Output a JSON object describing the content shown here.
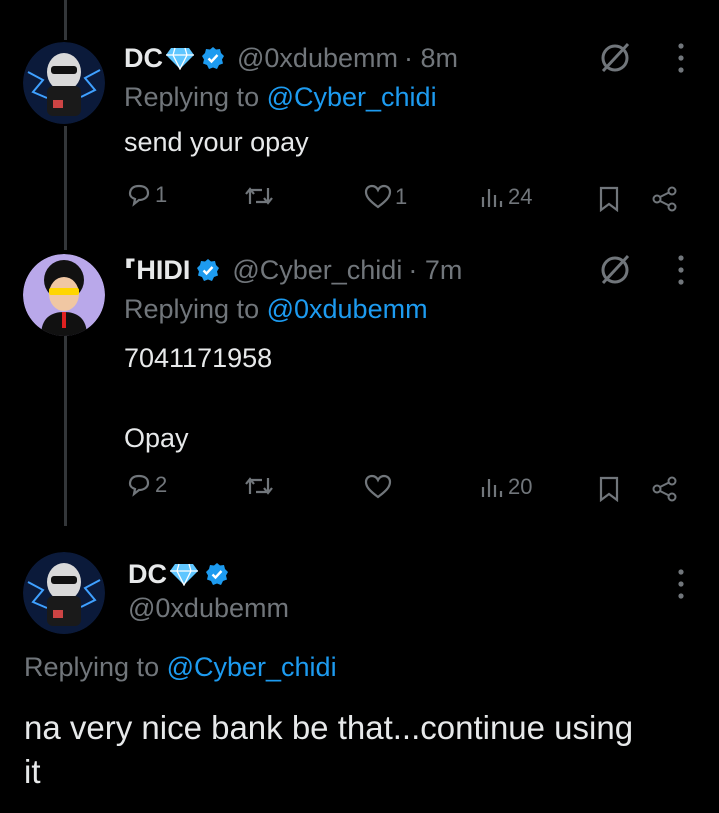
{
  "tweets": [
    {
      "name": "DC",
      "handle": "@0xdubemm",
      "time": "· 8m",
      "replying_prefix": "Replying to ",
      "replying_to": "@Cyber_chidi",
      "text": "send your opay",
      "stats": {
        "replies": "1",
        "likes": "1",
        "views": "24"
      }
    },
    {
      "name": "⸢HIDI",
      "handle": "@Cyber_chidi",
      "time": "· 7m",
      "replying_prefix": "Replying to ",
      "replying_to": "@0xdubemm",
      "text": "7041171958\n\nOpay",
      "stats": {
        "replies": "2",
        "likes": "",
        "views": "20"
      }
    },
    {
      "name": "DC",
      "handle": "@0xdubemm",
      "replying_prefix": "Replying to ",
      "replying_to": "@Cyber_chidi",
      "text": "na very nice bank be that...continue using it"
    }
  ],
  "icons": {
    "gem": "diamond-emoji",
    "verified": "verified-badge-icon",
    "grok": "grok-icon",
    "more": "more-vertical-icon",
    "reply": "reply-icon",
    "retweet": "retweet-icon",
    "like": "heart-icon",
    "views": "views-icon",
    "bookmark": "bookmark-icon",
    "share": "share-icon"
  },
  "colors": {
    "background": "#000000",
    "text": "#e7e9ea",
    "muted": "#71767b",
    "link": "#1d9bf0"
  }
}
